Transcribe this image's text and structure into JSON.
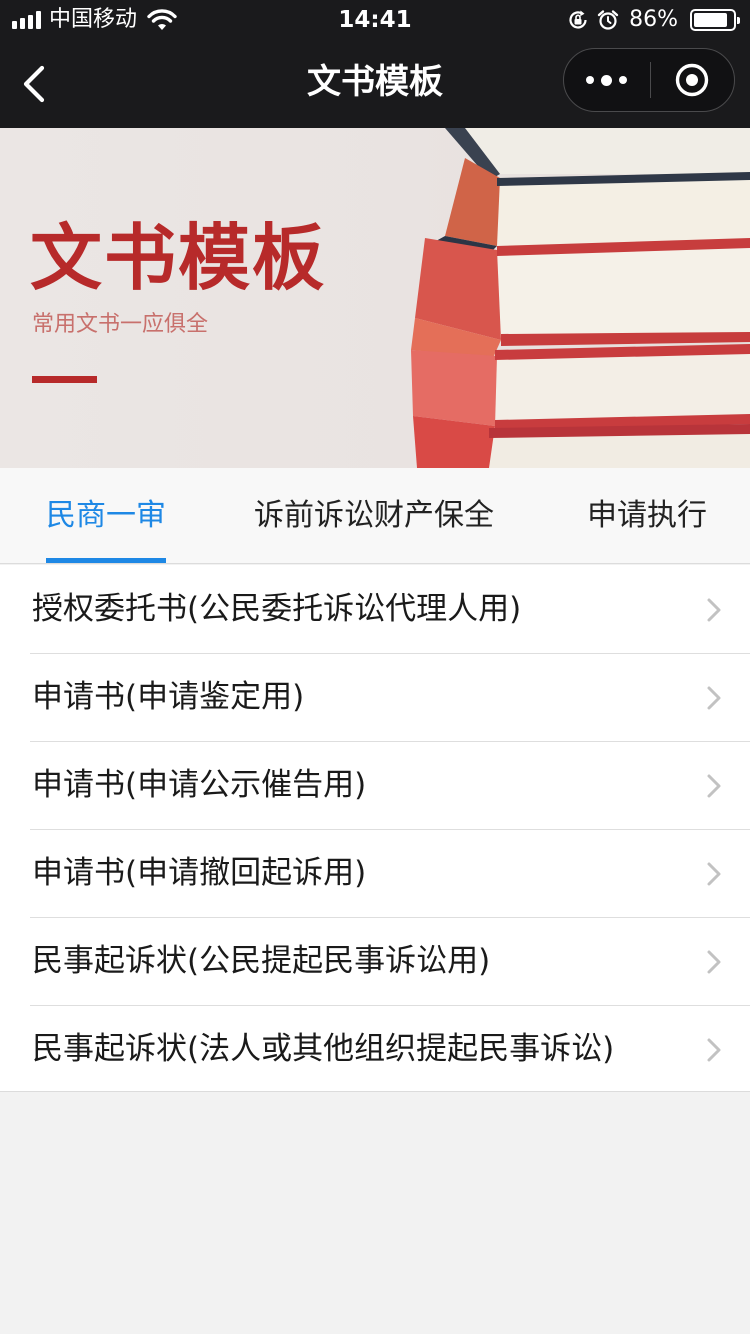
{
  "status_bar": {
    "carrier": "中国移动",
    "time": "14:41",
    "battery": "86%",
    "battery_level": 0.86,
    "icons": [
      "signal-icon",
      "wifi-icon",
      "rotation-lock-icon",
      "alarm-icon",
      "battery-icon"
    ]
  },
  "nav": {
    "title": "文书模板",
    "back_icon": "chevron-left-icon",
    "more_icon": "more-dots-icon",
    "close_icon": "target-circle-icon"
  },
  "banner": {
    "title": "文书模板",
    "subtitle": "常用文书一应俱全",
    "accent_color": "#b72a2a",
    "image": "stacked-books"
  },
  "tabs": [
    {
      "label": "民商一审",
      "active": true
    },
    {
      "label": "诉前诉讼财产保全",
      "active": false
    },
    {
      "label": "申请执行",
      "active": false
    }
  ],
  "documents": [
    {
      "label": "授权委托书(公民委托诉讼代理人用)"
    },
    {
      "label": "申请书(申请鉴定用)"
    },
    {
      "label": "申请书(申请公示催告用)"
    },
    {
      "label": "申请书(申请撤回起诉用)"
    },
    {
      "label": "民事起诉状(公民提起民事诉讼用)"
    },
    {
      "label": "民事起诉状(法人或其他组织提起民事诉讼)"
    }
  ],
  "colors": {
    "nav_background": "#1a1a1c",
    "active_tab": "#1e88e5",
    "banner_title": "#b72a2a",
    "banner_subtitle": "#c8706c"
  }
}
